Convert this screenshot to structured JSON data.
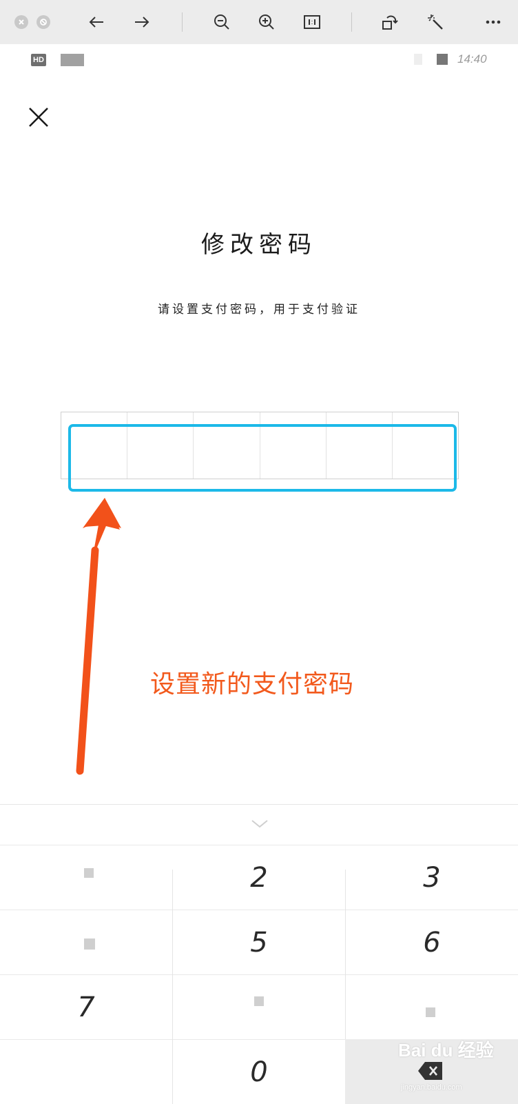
{
  "page": {
    "title": "修改密码",
    "subtitle": "请设置支付密码，用于支付验证"
  },
  "status_bar": {
    "badge": "HD",
    "time": "14:40"
  },
  "annotation": {
    "text": "设置新的支付密码",
    "color": "#f2591c",
    "highlight_color": "#1cb9e8"
  },
  "pin": {
    "cells": 6
  },
  "keypad": {
    "keys": [
      {
        "name": "key-1",
        "label": ""
      },
      {
        "name": "key-2",
        "label": "2"
      },
      {
        "name": "key-3",
        "label": "3"
      },
      {
        "name": "key-4",
        "label": ""
      },
      {
        "name": "key-5",
        "label": "5"
      },
      {
        "name": "key-6",
        "label": "6"
      },
      {
        "name": "key-7",
        "label": "7"
      },
      {
        "name": "key-8",
        "label": ""
      },
      {
        "name": "key-9",
        "label": ""
      },
      {
        "name": "key-0",
        "label": "0"
      }
    ]
  },
  "watermark": {
    "brand": "Bai du 经验",
    "url": "jingyan.baidu.com"
  },
  "icons": [
    "close-window-icon",
    "minimize-window-icon",
    "back-arrow-icon",
    "forward-arrow-icon",
    "zoom-out-icon",
    "zoom-in-icon",
    "actual-size-icon",
    "rotate-icon",
    "magic-wand-icon",
    "more-icon",
    "close-icon",
    "chevron-down-icon",
    "backspace-icon"
  ]
}
